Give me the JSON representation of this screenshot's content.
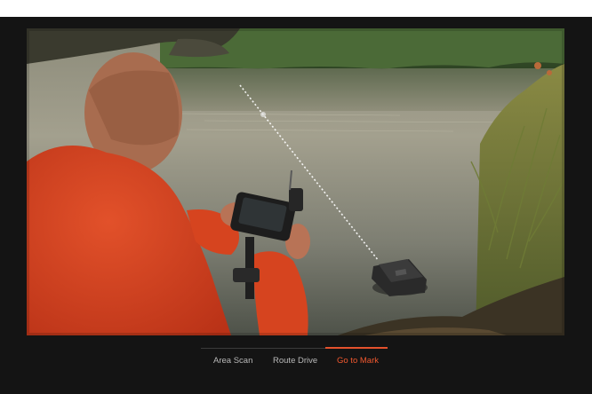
{
  "tabs": [
    {
      "label": "Area Scan",
      "active": false
    },
    {
      "label": "Route Drive",
      "active": false
    },
    {
      "label": "Go to Mark",
      "active": true
    }
  ],
  "colors": {
    "background": "#141414",
    "active_tab": "#f0582f",
    "inactive_tab": "#b9b9b9"
  }
}
